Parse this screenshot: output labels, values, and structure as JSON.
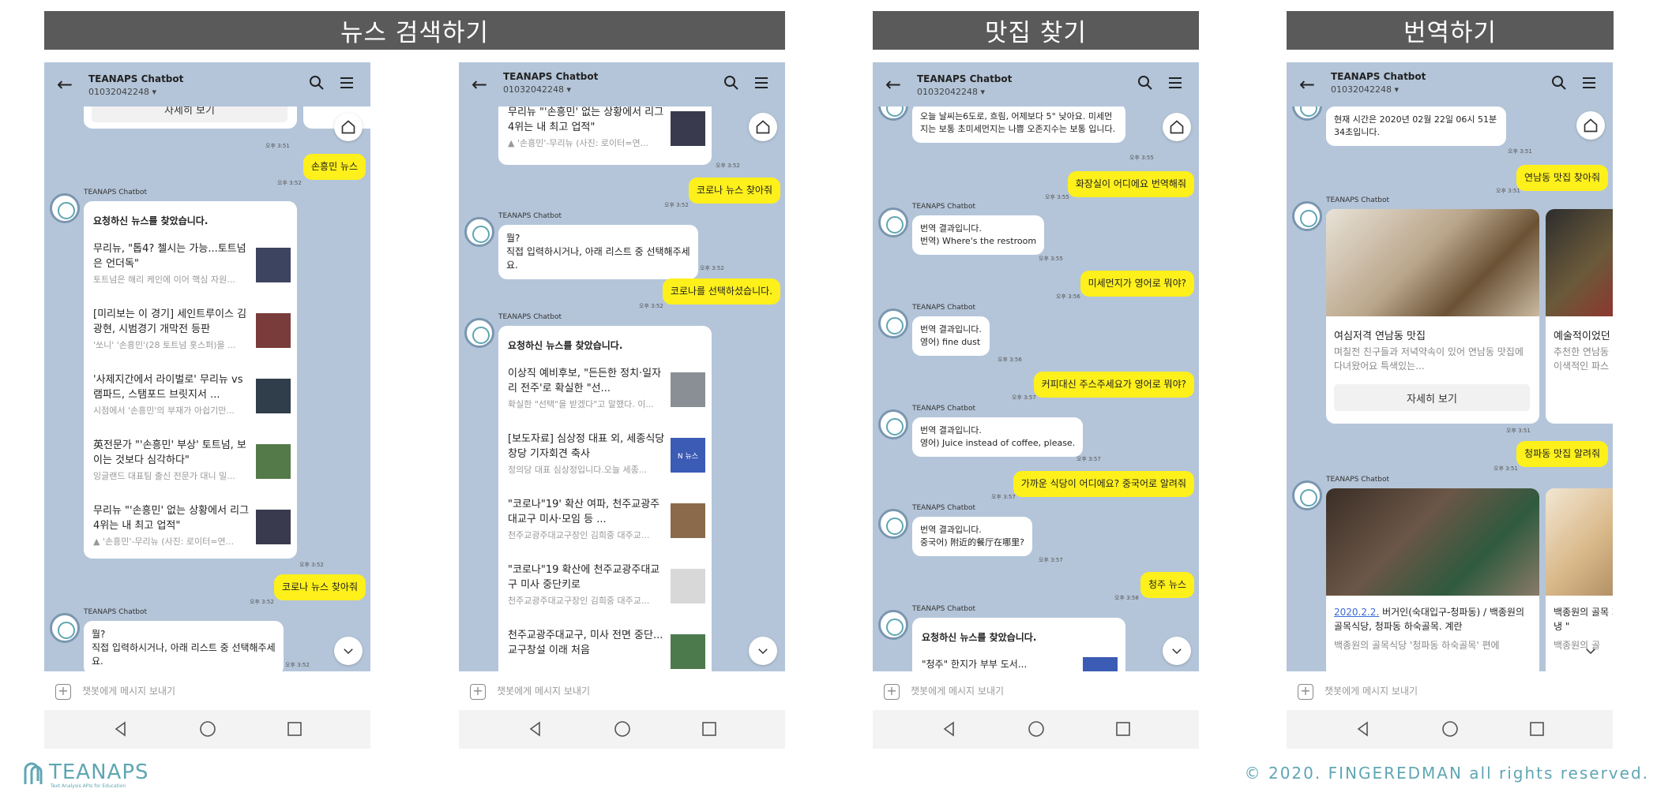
{
  "sections": [
    {
      "title": "뉴스 검색하기"
    },
    {
      "title": "맛집 찾기"
    },
    {
      "title": "번역하기"
    }
  ],
  "phone": {
    "chat_title": "TEANAPS Chatbot",
    "phone_number": "01032042248 ▾",
    "input_placeholder": "챗봇에게 메시지 보내기",
    "sender": "TEANAPS Chatbot"
  },
  "p1": {
    "detail_btn": "자세히 보기",
    "t1": "오후 3:51",
    "me1": "손흥민 뉴스",
    "t2": "오후 3:52",
    "card_head": "요청하신 뉴스를 찾았습니다.",
    "items": [
      {
        "title": "무리뉴, \"톱4? 첼시는 가능...토트넘은 언더독\"",
        "desc": "토트넘은 해리 케인에 이어 핵심 자원..."
      },
      {
        "title": "[미리보는 이 경기] 세인트루이스 김광현, 시범경기 개막전 등판",
        "desc": "'쏘니' '손흥민'(28 토트넘 홋스퍼)을 ..."
      },
      {
        "title": "'사제지간에서 라이벌로' 무리뉴 vs램파드, 스탬포드 브릿지서 ...",
        "desc": "시점에서 '손흥민'의 부재가 아쉽기만..."
      },
      {
        "title": "英전문가 \"'손흥민' 부상' 토트넘, 보이는 것보다 심각하다\"",
        "desc": "잉글랜드 대표팀 출신 전문가 대니 밀..."
      },
      {
        "title": "무리뉴 \"'손흥민' 없는 상황에서 리그 4위는 내 최고 업적\"",
        "desc": "▲ '손흥민'-무리뉴 (사진: 로이터=연..."
      }
    ],
    "t3": "오후 3:52",
    "me2": "코로나 뉴스 찾아줘",
    "t4": "오후 3:52",
    "bot_line1": "뭘?",
    "bot_line2": "직접 입력하시거나, 아래 리스트 중 선택해주세요.",
    "t5": "오후 3:52"
  },
  "p2": {
    "top_item_title": "무리뉴 \"'손흥민' 없는 상황에서 리그 4위는 내 최고 업적\"",
    "top_item_desc": "▲ '손흥민'-무리뉴 (사진: 로이터=연...",
    "t1": "오후 3:52",
    "me1": "코로나 뉴스 찾아줘",
    "t2": "오후 3:52",
    "bot_line1": "뭘?",
    "bot_line2": "직접 입력하시거나, 아래 리스트 중 선택해주세요.",
    "t3": "오후 3:52",
    "me2": "코로나를 선택하셨습니다.",
    "t4": "오후 3:52",
    "card_head": "요청하신 뉴스를 찾았습니다.",
    "items": [
      {
        "title": "이상직 예비후보, \"든든한 정치·일자리 전주'로 확실한 \"선...",
        "desc": "확실한 \"선택\"을 받겠다\"고 말했다. 이..."
      },
      {
        "title": "[보도자료] 심상정 대표 외, 세종식당 창당 기자회견 축사",
        "desc": "정의당 대표 심상정입니다.오늘 세종..."
      },
      {
        "title": "\"코로나\"19' 확산 여파, 천주교광주대교구 미사·모임 등 ...",
        "desc": "천주교광주대교구장인 김희중 대주교..."
      },
      {
        "title": "\"코로나\"19 확산에 천주교광주대교구 미사 중단키로",
        "desc": "천주교광주대교구장인 김희중 대주교..."
      },
      {
        "title": "천주교광주대교구, 미사 전면 중단...교구창설 이래 처음",
        "desc": ""
      }
    ],
    "news_badge": "N 뉴스"
  },
  "p3": {
    "weather": "오늘 날씨는6도로, 흐림, 어제보다 5° 낮아요. 미세먼지는 보통 초미세먼지는 나쁨 오존지수는 보통 입니다.",
    "t1": "오후 3:55",
    "me1": "화장실이 어디에요 번역해줘",
    "t2": "오후 3:55",
    "r1a": "번역 결과입니다.",
    "r1b": "번역) Where's the restroom",
    "t3": "오후 3:55",
    "me2": "미세먼지가 영어로 뭐야?",
    "t4": "오후 3:56",
    "r2a": "번역 결과입니다.",
    "r2b": "영어) fine dust",
    "t5": "오후 3:56",
    "me3": "커피대신 주스주세요가 영어로 뭐야?",
    "t6": "오후 3:57",
    "r3a": "번역 결과입니다.",
    "r3b": "영어) Juice instead of coffee, please.",
    "t7": "오후 3:57",
    "me4": "가까운 식당이 어디에요? 중국어로 알려줘",
    "t8": "오후 3:57",
    "r4a": "번역 결과입니다.",
    "r4b": "중국어) 附近的餐厅在哪里?",
    "t9": "오후 3:57",
    "me5": "청주 뉴스",
    "t10": "오후 3:58",
    "card_head": "요청하신 뉴스를 찾았습니다.",
    "card_item": "\"청주\" 한지가 부부 도서..."
  },
  "p4": {
    "time_msg": "현재 시간은 2020년 02월 22일 06시 51분 34초입니다.",
    "t1": "오후 3:51",
    "me1": "연남동 맛집 찾아줘",
    "t2": "오후 3:51",
    "r1_title": "여심저격 연남동 맛집",
    "r1_desc": "며칠전 친구들과 저녁약속이 있어 연남동 맛집에 다녀왔어요 특색있는...",
    "r1_btn": "자세히 보기",
    "r2_title": "예술적이었던",
    "r2_desc": "추천한 연남동 이색적인 파스",
    "t3": "오후 3:51",
    "me2": "청파동 맛집 알려줘",
    "t4": "오후 3:51",
    "r3_link": "2020.2.2.",
    "r3_title": " 버거인(숙대입구-청파동) / 백종원의 골목식당, 청파동 하숙골목. 계란",
    "r3_desc": "백종원의 골목식당 '청파동 하숙골목' 편에",
    "r4_title": "백종원의 골목 회냉 \"",
    "r4_desc": "백종원의 골"
  },
  "footer": {
    "logo_text": "TEANAPS",
    "logo_sub": "Text Analysis APIs for Education",
    "copyright": "© 2020. FINGEREDMAN all rights reserved."
  }
}
